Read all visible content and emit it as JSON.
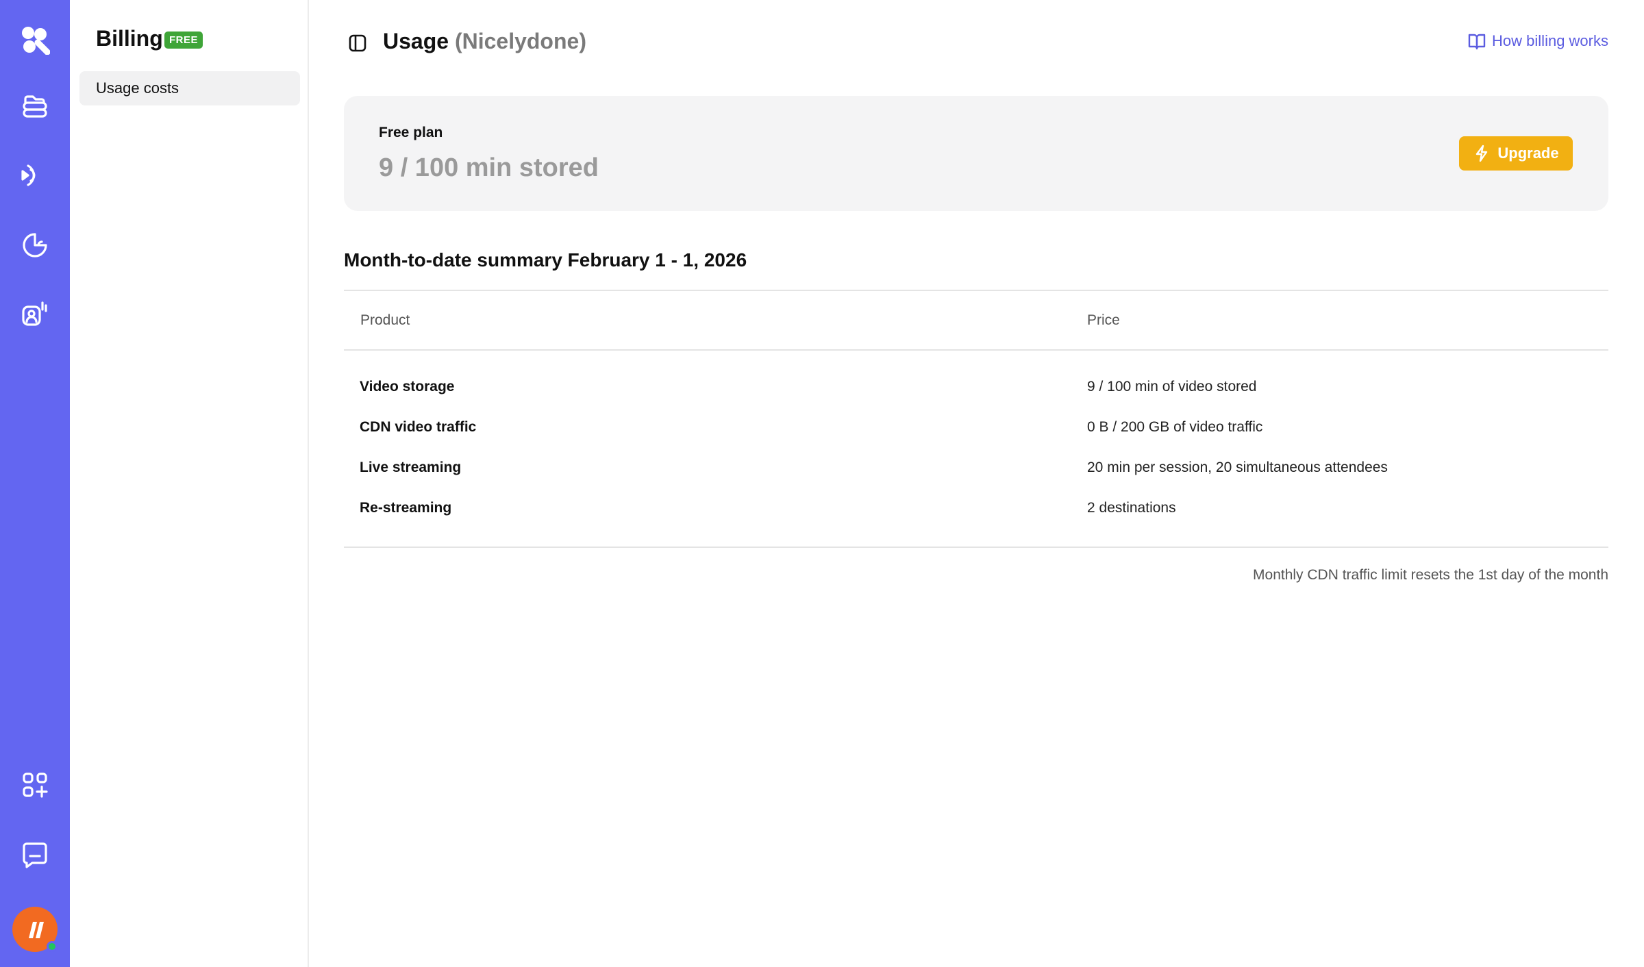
{
  "nav": {
    "items": [
      {
        "icon": "logo-icon"
      },
      {
        "icon": "videos-icon"
      },
      {
        "icon": "live-icon"
      },
      {
        "icon": "analytics-icon"
      },
      {
        "icon": "engagement-icon"
      }
    ],
    "bottom": [
      {
        "icon": "apps-icon"
      },
      {
        "icon": "chat-icon"
      }
    ],
    "avatar_color": "#f26a21"
  },
  "sidebar": {
    "title": "Billing",
    "badge": "FREE",
    "items": [
      {
        "label": "Usage costs",
        "active": true
      }
    ]
  },
  "header": {
    "title": "Usage",
    "workspace": "(Nicelydone)",
    "help_link": "How billing works"
  },
  "plan": {
    "label": "Free plan",
    "value": "9 / 100 min stored",
    "upgrade_label": "Upgrade"
  },
  "summary": {
    "title": "Month-to-date summary February 1 - 1, 2026",
    "columns": [
      "Product",
      "Price"
    ],
    "rows": [
      {
        "product": "Video storage",
        "price": "9 / 100 min of video stored"
      },
      {
        "product": "CDN video traffic",
        "price": "0 B / 200 GB of video traffic"
      },
      {
        "product": "Live streaming",
        "price": "20 min per session, 20 simultaneous attendees"
      },
      {
        "product": "Re-streaming",
        "price": "2 destinations"
      }
    ],
    "footnote": "Monthly CDN traffic limit resets the 1st day of the month"
  },
  "colors": {
    "rail": "#6366f1",
    "accent_link": "#5b5ce0",
    "upgrade": "#f2b012",
    "badge": "#3fa538"
  }
}
